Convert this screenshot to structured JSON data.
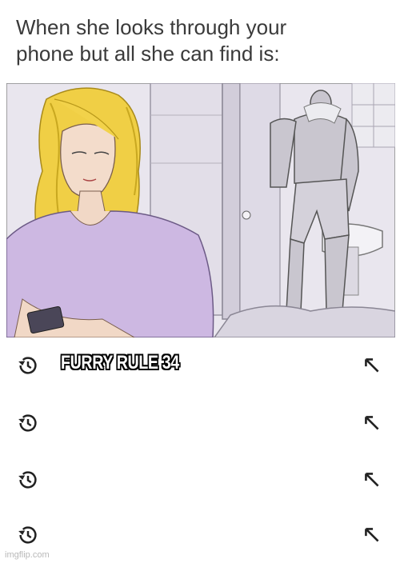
{
  "caption": {
    "line1": "When she looks through your",
    "line2": "phone but all she can find is:"
  },
  "search_history": {
    "items": [
      {
        "query": "FURRY RULE 34",
        "history_icon": "history-clock-icon",
        "action_icon": "arrow-up-left-icon"
      },
      {
        "query": "",
        "history_icon": "history-clock-icon",
        "action_icon": "arrow-up-left-icon"
      },
      {
        "query": "",
        "history_icon": "history-clock-icon",
        "action_icon": "arrow-up-left-icon"
      },
      {
        "query": "",
        "history_icon": "history-clock-icon",
        "action_icon": "arrow-up-left-icon"
      }
    ]
  },
  "watermark": "imgflip.com",
  "colors": {
    "text": "#3a3a3a",
    "icon": "#222222",
    "shirt": "#cdb8e2",
    "hair": "#f2d24a",
    "bathroom": "#e6e4ec"
  }
}
